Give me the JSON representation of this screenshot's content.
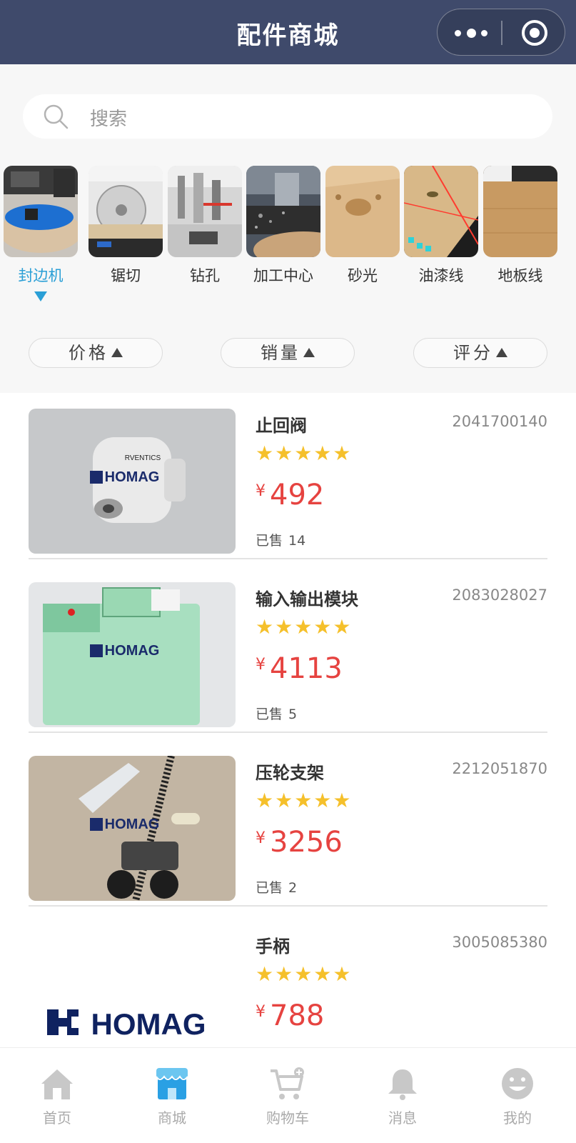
{
  "header": {
    "title": "配件商城"
  },
  "search": {
    "placeholder": "搜索"
  },
  "categories": [
    {
      "label": "封边机",
      "active": true
    },
    {
      "label": "锯切"
    },
    {
      "label": "钻孔"
    },
    {
      "label": "加工中心"
    },
    {
      "label": "砂光"
    },
    {
      "label": "油漆线"
    },
    {
      "label": "地板线"
    }
  ],
  "sorts": [
    {
      "label": "价格"
    },
    {
      "label": "销量"
    },
    {
      "label": "评分"
    }
  ],
  "products": [
    {
      "name": "止回阀",
      "code": "2041700140",
      "stars": "★★★★★",
      "currency": "¥",
      "price": "492",
      "sold_label": "已售",
      "sold": "14",
      "logo": "HOMAG",
      "brand": "RVENTICS"
    },
    {
      "name": "输入输出模块",
      "code": "2083028027",
      "stars": "★★★★★",
      "currency": "¥",
      "price": "4113",
      "sold_label": "已售",
      "sold": "5",
      "logo": "HOMAG"
    },
    {
      "name": "压轮支架",
      "code": "2212051870",
      "stars": "★★★★★",
      "currency": "¥",
      "price": "3256",
      "sold_label": "已售",
      "sold": "2",
      "logo": "HOMAG"
    },
    {
      "name": "手柄",
      "code": "3005085380",
      "stars": "★★★★★",
      "currency": "¥",
      "price": "788",
      "logo": "HOMAG"
    }
  ],
  "tabbar": [
    {
      "label": "首页",
      "icon": "home-icon"
    },
    {
      "label": "商城",
      "icon": "store-icon",
      "active": true
    },
    {
      "label": "购物车",
      "icon": "cart-icon"
    },
    {
      "label": "消息",
      "icon": "bell-icon"
    },
    {
      "label": "我的",
      "icon": "smiley-icon"
    }
  ],
  "colors": {
    "header": "#3f4a6b",
    "accent": "#2a9fd6",
    "price": "#e64340",
    "star": "#f5c02b"
  }
}
